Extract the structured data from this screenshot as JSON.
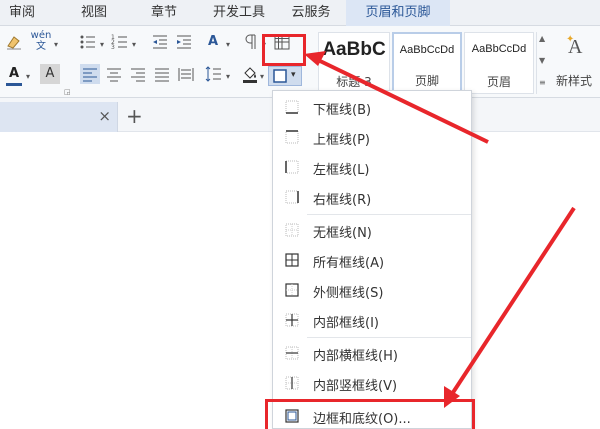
{
  "menu": {
    "tabs": [
      "审阅",
      "视图",
      "章节",
      "开发工具",
      "云服务",
      "页眉和页脚"
    ]
  },
  "ribbon": {
    "font_phonetic": "wén\n文",
    "grow_font_label": "A",
    "styles": [
      {
        "sample": "AaBbC",
        "name": "标题 3"
      },
      {
        "sample": "AaBbCcDd",
        "name": "页脚"
      },
      {
        "sample": "AaBbCcDd",
        "name": "页眉"
      }
    ],
    "new_style_label": "新样式"
  },
  "doc_tabs": {
    "close_glyph": "×",
    "add_glyph": "+"
  },
  "border_menu": {
    "items": [
      {
        "label": "下框线(B)",
        "icon": "bottom-border-icon"
      },
      {
        "label": "上框线(P)",
        "icon": "top-border-icon"
      },
      {
        "label": "左框线(L)",
        "icon": "left-border-icon"
      },
      {
        "label": "右框线(R)",
        "icon": "right-border-icon"
      },
      {
        "label": "无框线(N)",
        "icon": "no-border-icon"
      },
      {
        "label": "所有框线(A)",
        "icon": "all-borders-icon"
      },
      {
        "label": "外侧框线(S)",
        "icon": "outside-borders-icon"
      },
      {
        "label": "内部框线(I)",
        "icon": "inside-borders-icon"
      },
      {
        "label": "内部横框线(H)",
        "icon": "inside-horizontal-border-icon"
      },
      {
        "label": "内部竖框线(V)",
        "icon": "inside-vertical-border-icon"
      },
      {
        "label": "边框和底纹(O)...",
        "icon": "borders-shading-icon"
      }
    ]
  },
  "colors": {
    "accent": "#2b5797",
    "highlight": "#e8262b",
    "active_tab": "#dce6f5"
  }
}
